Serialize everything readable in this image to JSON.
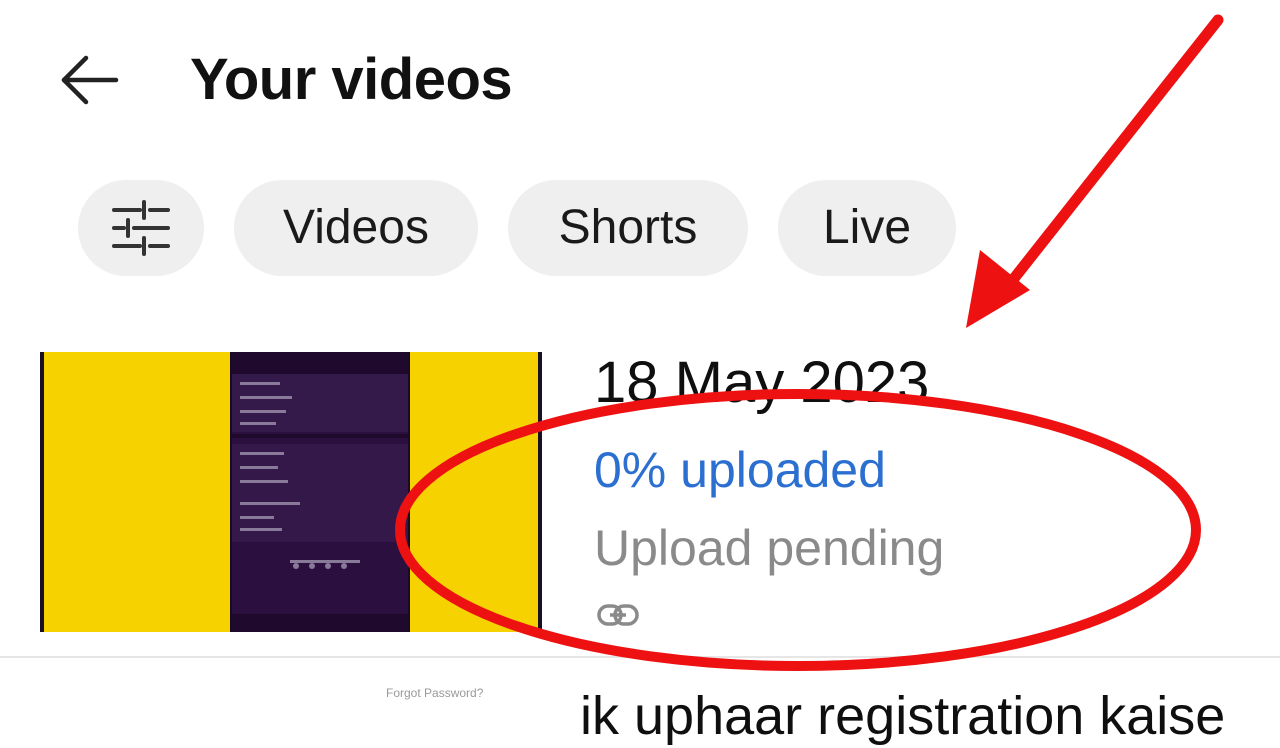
{
  "header": {
    "title": "Your videos",
    "back_icon": "arrow-left-icon"
  },
  "filters": {
    "filter_icon": "sliders-icon",
    "chips": [
      "Videos",
      "Shorts",
      "Live"
    ]
  },
  "video": {
    "date": "18 May 2023",
    "upload_progress": "0% uploaded",
    "upload_progress_percent": 0,
    "status": "Upload pending",
    "visibility_icon": "link-icon",
    "thumbnail_colors": {
      "background": "#f6d200",
      "phone": "#2b0f3e"
    }
  },
  "next_video": {
    "thumb_caption": "Forgot Password?",
    "title": "ik uphaar registration kaise"
  },
  "colors": {
    "progress_text": "#2b6fd1",
    "annotation": "#ee1111"
  }
}
